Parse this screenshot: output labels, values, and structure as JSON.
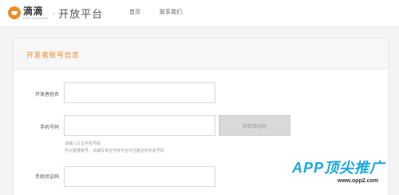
{
  "header": {
    "brand": "滴滴",
    "brand_sub": "DIDI CHUXING",
    "separator": "·",
    "platform_title": "开放平台",
    "nav": [
      "首页",
      "联系我们"
    ]
  },
  "form": {
    "section_title": "开发者账号信息",
    "developer_name_label": "开发者姓名",
    "developer_name_value": "",
    "phone_label": "手机号码",
    "phone_value": "",
    "get_code_button": "获取验证码",
    "phone_hint_line1": "请输入11位手机号码",
    "phone_hint_line2": "作为登录账号，请填写未在开放平台中注册过的手机号码",
    "code_label": "手机验证码",
    "code_value": ""
  },
  "watermark": {
    "text": "APP顶尖推广",
    "url": "www.opp2.com"
  },
  "colors": {
    "accent": "#f08c24",
    "watermark": "#1ba7e0"
  }
}
